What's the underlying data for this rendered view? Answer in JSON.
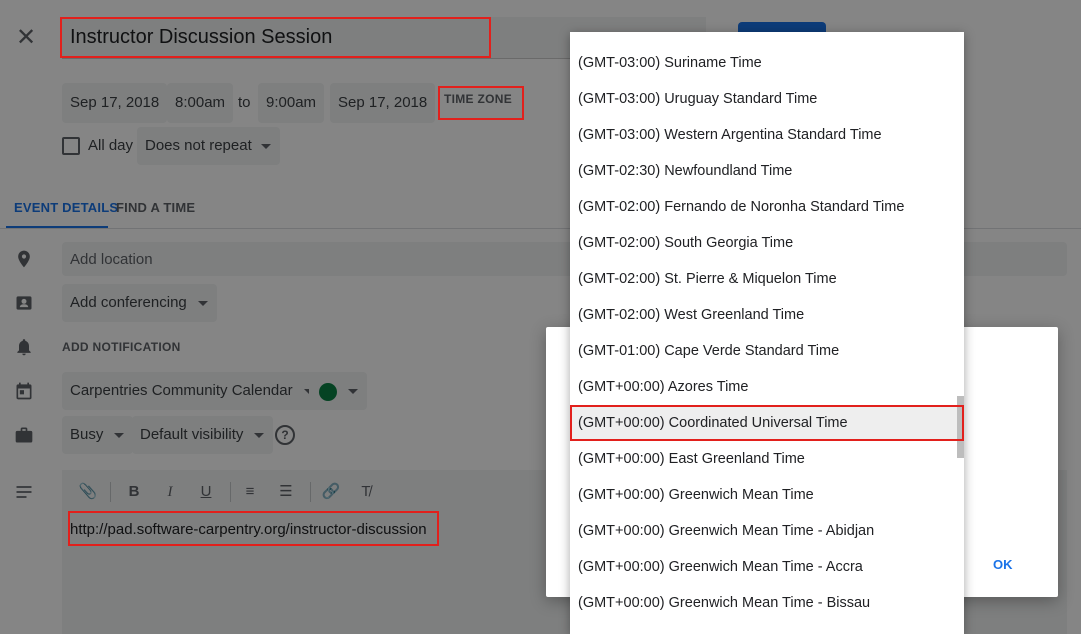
{
  "header": {
    "close_icon": "close-icon",
    "title": "Instructor Discussion Session"
  },
  "datetime": {
    "start_date": "Sep 17, 2018",
    "start_time": "8:00am",
    "to_label": "to",
    "end_time": "9:00am",
    "end_date": "Sep 17, 2018",
    "time_zone_label": "TIME ZONE"
  },
  "options": {
    "all_day_label": "All day",
    "all_day_checked": false,
    "repeat": "Does not repeat"
  },
  "tabs": [
    {
      "label": "EVENT DETAILS",
      "active": true
    },
    {
      "label": "FIND A TIME",
      "active": false
    }
  ],
  "details": {
    "location_placeholder": "Add location",
    "conferencing": "Add conferencing",
    "add_notification": "ADD NOTIFICATION",
    "calendar": "Carpentries Community Calendar",
    "calendar_color": "#0b8043",
    "availability": "Busy",
    "visibility": "Default visibility",
    "description": "http://pad.software-carpentry.org/instructor-discussion"
  },
  "dialog": {
    "ok_label": "OK"
  },
  "timezone_list": {
    "items": [
      {
        "label": "(GMT-03:00) Suriname Time"
      },
      {
        "label": "(GMT-03:00) Uruguay Standard Time"
      },
      {
        "label": "(GMT-03:00) Western Argentina Standard Time"
      },
      {
        "label": "(GMT-02:30) Newfoundland Time"
      },
      {
        "label": "(GMT-02:00) Fernando de Noronha Standard Time"
      },
      {
        "label": "(GMT-02:00) South Georgia Time"
      },
      {
        "label": "(GMT-02:00) St. Pierre & Miquelon Time"
      },
      {
        "label": "(GMT-02:00) West Greenland Time"
      },
      {
        "label": "(GMT-01:00) Cape Verde Standard Time"
      },
      {
        "label": "(GMT+00:00) Azores Time"
      },
      {
        "label": "(GMT+00:00) Coordinated Universal Time",
        "selected": true
      },
      {
        "label": "(GMT+00:00) East Greenland Time"
      },
      {
        "label": "(GMT+00:00) Greenwich Mean Time"
      },
      {
        "label": "(GMT+00:00) Greenwich Mean Time - Abidjan"
      },
      {
        "label": "(GMT+00:00) Greenwich Mean Time - Accra"
      },
      {
        "label": "(GMT+00:00) Greenwich Mean Time - Bissau"
      }
    ]
  },
  "colors": {
    "accent": "#1a73e8",
    "highlight": "#e2201c"
  }
}
